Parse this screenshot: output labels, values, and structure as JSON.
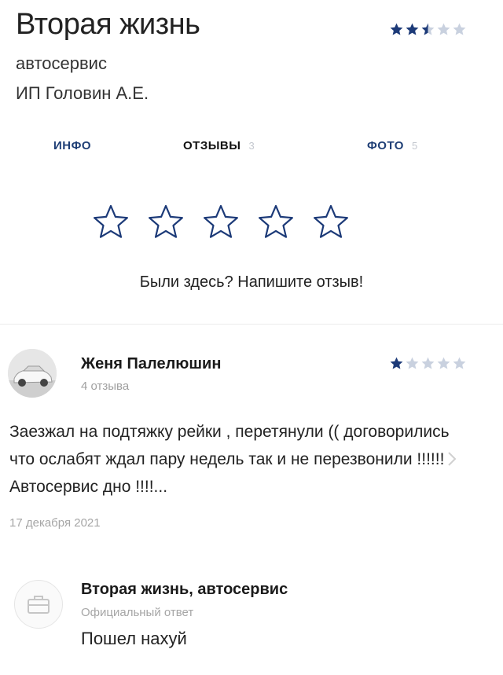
{
  "business": {
    "name": "Вторая жизнь",
    "category": "автосервис",
    "owner": "ИП Головин А.Е.",
    "rating_stars": 2.5
  },
  "tabs": [
    {
      "label": "ИНФО",
      "count": ""
    },
    {
      "label": "ОТЗЫВЫ",
      "count": "3"
    },
    {
      "label": "ФОТО",
      "count": "5"
    }
  ],
  "rate_prompt": "Были здесь? Напишите отзыв!",
  "review": {
    "author": "Женя Палелюшин",
    "author_reviews": "4 отзыва",
    "stars": 1,
    "text": "Заезжал на подтяжку рейки , перетянули (( договорились что ослабят ждал пару недель так и не перезвонили !!!!!! Автосервис дно !!!!...",
    "date": "17 декабря 2021"
  },
  "reply": {
    "author": "Вторая жизнь, автосервис",
    "label": "Официальный ответ",
    "text": "Пошел нахуй"
  },
  "colors": {
    "star_filled": "#1c3a78",
    "star_empty": "#c9d1df",
    "tab_accent": "#1f3f76"
  }
}
